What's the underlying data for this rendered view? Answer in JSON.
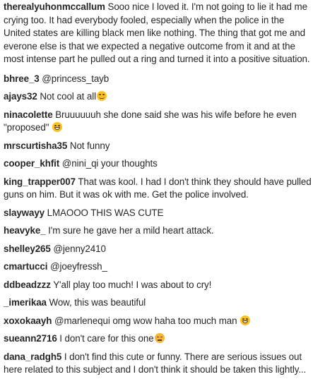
{
  "comments": [
    {
      "user": "therealyuhonmccallum",
      "text": "Sooo nice I loved it. I'm not going to lie it had me crying too. It had everybody fooled, especially when the police in the United states are killing black men like nothing. The thing that got me and everone else is that we expected a negative outcome from it and at the most intense part he pulled out a ring and turned it into a positive situation."
    },
    {
      "user": "bhree_3",
      "text": "@princess_tayb"
    },
    {
      "user": "ajays32",
      "text": "Not cool at all",
      "emoji": "smiling-face-icon"
    },
    {
      "user": "ninacolette",
      "text": "Bruuuuuuh she done said she was his wife before he even \"proposed\"",
      "emoji": "tears-of-joy-icon"
    },
    {
      "user": "mrscurtisha35",
      "text": "Not funny"
    },
    {
      "user": "cooper_khfit",
      "text": "@nini_qi your thoughts"
    },
    {
      "user": "king_trapper007",
      "text": "That was kool. I had I don't think they should have pulled guns on him. But it was ok with me. Get the police involved."
    },
    {
      "user": "slaywayy",
      "text": "LMAOOO THIS WAS CUTE"
    },
    {
      "user": "heavyke_",
      "text": "I'm sure he gave her a mild heart attack."
    },
    {
      "user": "shelley265",
      "text": "@jenny2410"
    },
    {
      "user": "cmartucci",
      "text": "@joeyfressh_"
    },
    {
      "user": "ddbeadzzz",
      "text": "Y'all play too much! I was about to cry!"
    },
    {
      "user": "_imerikaa",
      "text": "Wow, this was beautiful"
    },
    {
      "user": "xoxokaayh",
      "text": "@marlenequi omg wow haha too much man",
      "emoji": "tears-of-joy-icon"
    },
    {
      "user": "sueann2716",
      "text": "I don't care for this one",
      "emoji": "unamused-face-icon"
    },
    {
      "user": "dana_radgh5",
      "text": "I don't find this cute or funny. There are serious issues out here related to this subject and I don't think it should be taken this lightly..."
    }
  ]
}
